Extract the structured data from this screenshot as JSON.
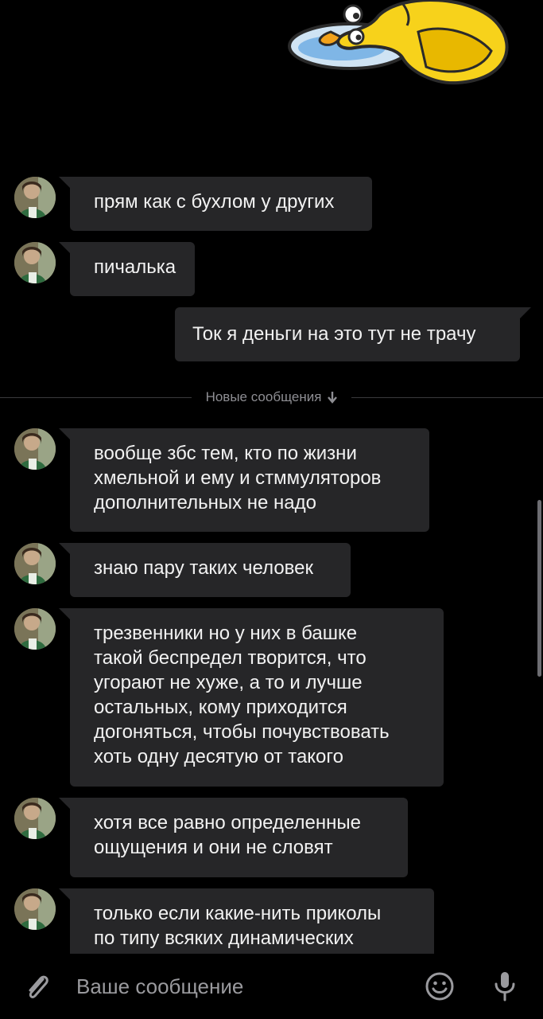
{
  "sticker": {
    "icon": "yellow-duck-sticker-icon"
  },
  "messages": [
    {
      "direction": "in",
      "text": "прям как с бухлом у других"
    },
    {
      "direction": "in",
      "text": "пичалька"
    },
    {
      "direction": "out",
      "text": "Ток я деньги на это тут не трачу"
    },
    {
      "direction": "in",
      "text": "вообще збс тем, кто по жизни\nхмельной и ему и стммуляторов\nдополнительных не надо"
    },
    {
      "direction": "in",
      "text": "знаю пару таких человек"
    },
    {
      "direction": "in",
      "text": "трезвенники но у них в башке\nтакой беспредел творится, что\nугорают не хуже, а то и лучше\nостальных, кому приходится\nдогоняться, чтобы почувствовать\nхоть одну десятую от такого"
    },
    {
      "direction": "in",
      "text": "хотя все равно определенные\nощущения и они не словят"
    },
    {
      "direction": "in",
      "text": "только если какие-нить приколы\nпо типу всяких динамических"
    }
  ],
  "divider": {
    "label": "Новые сообщения",
    "icon": "arrow-down-icon"
  },
  "composer": {
    "placeholder": "Ваше сообщение",
    "attach_icon": "paperclip-icon",
    "emoji_icon": "smiley-icon",
    "mic_icon": "microphone-icon"
  },
  "colors": {
    "background": "#000000",
    "bubble": "#262628",
    "text": "#f2f2f2",
    "muted": "#8e8e93"
  }
}
